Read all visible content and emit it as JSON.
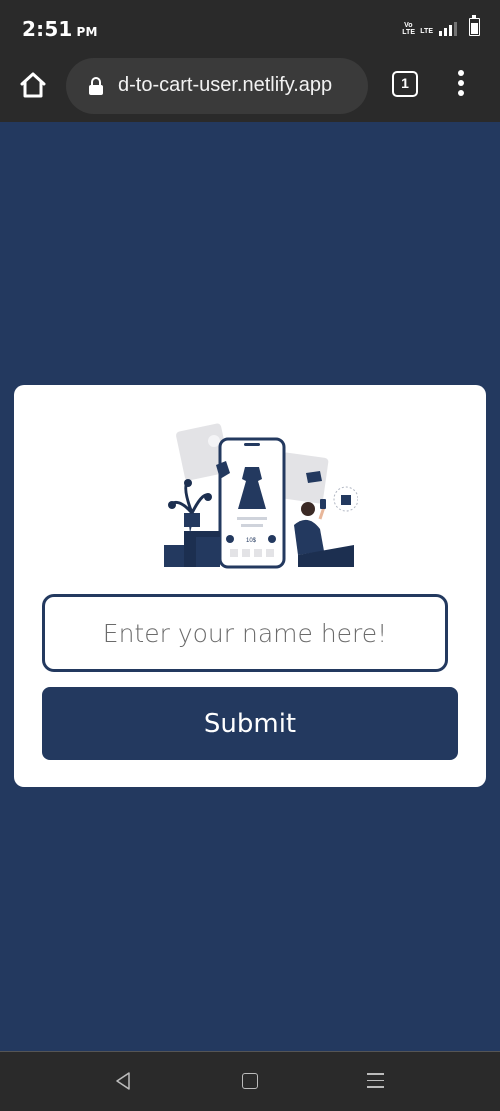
{
  "status_bar": {
    "time": "2:51",
    "ampm": "PM",
    "volte_label": "Vo LTE",
    "lte_label": "LTE",
    "icons": [
      "volte-icon",
      "lte-signal-icon",
      "battery-icon"
    ]
  },
  "browser": {
    "url": "d-to-cart-user.netlify.app",
    "tab_count": "1",
    "icons": [
      "home-icon",
      "lock-icon",
      "tab-switcher-icon",
      "more-menu-icon"
    ]
  },
  "form": {
    "name_placeholder": "Enter your name here!",
    "name_value": "",
    "submit_label": "Submit"
  },
  "illustration": {
    "price_tag": "10$"
  },
  "nav_bar": {
    "icons": [
      "back-icon",
      "home-square-icon",
      "recents-icon"
    ]
  },
  "colors": {
    "primary": "#23395f",
    "card_bg": "#ffffff",
    "chrome_bg": "#2a2a2a"
  }
}
